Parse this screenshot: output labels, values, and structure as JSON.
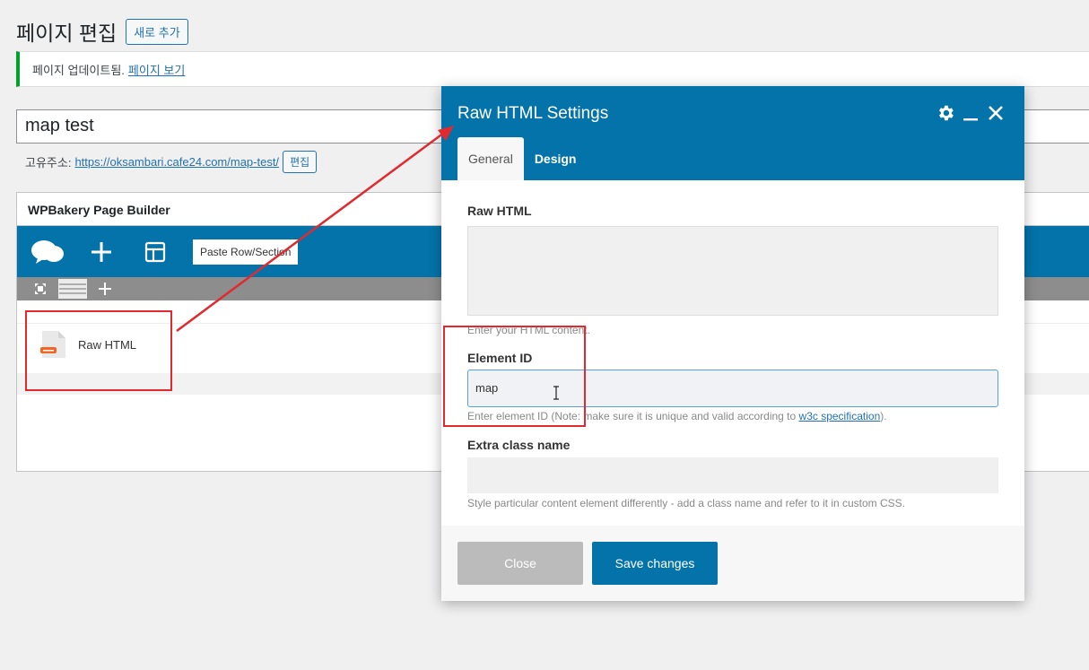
{
  "header": {
    "title": "페이지 편집",
    "add_new": "새로 추가"
  },
  "notice": {
    "text": "페이지 업데이트됨.",
    "link": "페이지 보기"
  },
  "post": {
    "title": "map test"
  },
  "permalink": {
    "label": "고유주소:",
    "url": "https://oksambari.cafe24.com/map-test/",
    "edit": "편집"
  },
  "builder": {
    "title": "WPBakery Page Builder",
    "paste_label": "Paste Row/Section",
    "element_label": "Raw HTML"
  },
  "modal": {
    "title": "Raw HTML Settings",
    "tabs": [
      "General",
      "Design"
    ],
    "fields": {
      "raw_html_label": "Raw HTML",
      "raw_html_help": "Enter your HTML content.",
      "element_id_label": "Element ID",
      "element_id_value": "map",
      "element_id_help": "Enter element ID (Note: make sure it is unique and valid according to",
      "element_id_link": "w3c specification",
      "element_id_help_end": ").",
      "extra_class_label": "Extra class name",
      "extra_class_help": "Style particular content element differently - add a class name and refer to it in custom CSS."
    },
    "buttons": {
      "close": "Close",
      "save": "Save changes"
    }
  },
  "colors": {
    "accent": "#0473aa",
    "annotation": "#e02a2f",
    "notice": "#00a32a"
  }
}
